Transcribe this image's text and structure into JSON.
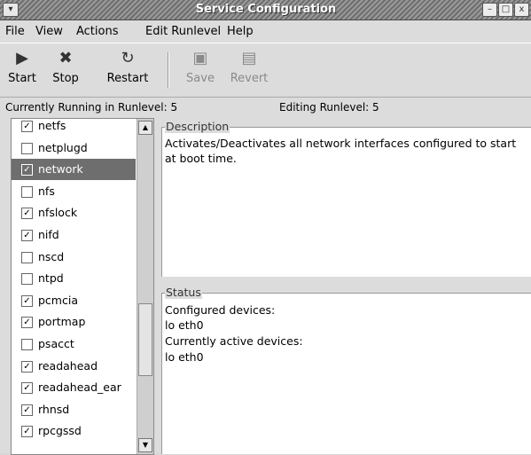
{
  "window": {
    "title": "Service Configuration",
    "menu_icon": "chevron-down-icon",
    "minimize": "–",
    "maximize": "□",
    "close": "x"
  },
  "menubar": {
    "file": "File",
    "view": "View",
    "actions": "Actions",
    "edit_runlevel": "Edit Runlevel",
    "help": "Help"
  },
  "toolbar": {
    "start": "Start",
    "stop": "Stop",
    "restart": "Restart",
    "save": "Save",
    "revert": "Revert"
  },
  "status": {
    "running": "Currently Running in Runlevel: 5",
    "editing": "Editing Runlevel: 5"
  },
  "services": [
    {
      "name": "netfs",
      "checked": true
    },
    {
      "name": "netplugd",
      "checked": false
    },
    {
      "name": "network",
      "checked": true,
      "selected": true
    },
    {
      "name": "nfs",
      "checked": false
    },
    {
      "name": "nfslock",
      "checked": true
    },
    {
      "name": "nifd",
      "checked": true
    },
    {
      "name": "nscd",
      "checked": false
    },
    {
      "name": "ntpd",
      "checked": false
    },
    {
      "name": "pcmcia",
      "checked": true
    },
    {
      "name": "portmap",
      "checked": true
    },
    {
      "name": "psacct",
      "checked": false
    },
    {
      "name": "readahead",
      "checked": true
    },
    {
      "name": "readahead_ear",
      "checked": true
    },
    {
      "name": "rhnsd",
      "checked": true
    },
    {
      "name": "rpcgssd",
      "checked": true
    }
  ],
  "description": {
    "label": "Description",
    "text": "Activates/Deactivates all network interfaces configured to start at boot time."
  },
  "status_panel": {
    "label": "Status",
    "lines": [
      "Configured devices:",
      "lo eth0",
      "Currently active devices:",
      "lo eth0"
    ]
  }
}
